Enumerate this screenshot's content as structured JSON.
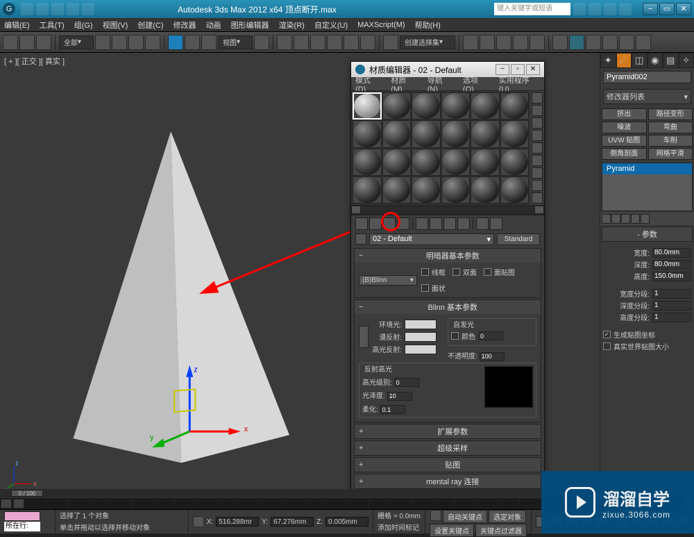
{
  "titlebar": {
    "title": "Autodesk 3ds Max  2012 x64    顶点断开.max",
    "search_placeholder": "键入关键字或短语"
  },
  "menubar": [
    "编辑(E)",
    "工具(T)",
    "组(G)",
    "视图(V)",
    "创建(C)",
    "修改器",
    "动画",
    "图形编辑器",
    "渲染(R)",
    "自定义(U)",
    "MAXScript(M)",
    "帮助(H)"
  ],
  "toolbar": {
    "group_dd": "全部",
    "view_dd": "视图",
    "select_set": "创建选择集"
  },
  "viewport_label": "[ + ][ 正交 ][ 真实 ]",
  "material_editor": {
    "title": "材质编辑器 - 02 - Default",
    "menu": [
      "模式(D)",
      "材质(M)",
      "导航(N)",
      "选项(O)",
      "实用程序(U)"
    ],
    "mat_name": "02 - Default",
    "mat_type": "Standard",
    "rollout_shader": "明暗器基本参数",
    "shader": "(B)Blinn",
    "check_wire": "线框",
    "check_2sided": "双面",
    "check_facemap": "面贴图",
    "check_faceted": "面状",
    "rollout_blinn": "Blinn 基本参数",
    "grp_selfillum": "自发光",
    "lbl_ambient": "环境光:",
    "lbl_diffuse": "漫反射:",
    "lbl_specular": "高光反射:",
    "lbl_color": "颜色",
    "lbl_opacity": "不透明度:",
    "val_opacity": "100",
    "grp_reflect": "反射高光",
    "lbl_speclevel": "高光级别:",
    "val_speclevel": "0",
    "lbl_gloss": "光泽度:",
    "val_gloss": "10",
    "lbl_soften": "柔化:",
    "val_soften": "0.1",
    "rollout_ext": "扩展参数",
    "rollout_super": "超级采样",
    "rollout_maps": "贴图",
    "rollout_mr": "mental ray 连接"
  },
  "cmdpanel": {
    "obj_name": "Pyramid002",
    "mod_dd": "修改器列表",
    "mod_btns": [
      "挤出",
      "路径变形",
      "噪波",
      "弯曲",
      "UVW 贴图",
      "车削",
      "倒角剖面",
      "网格平滑"
    ],
    "stack_item": "Pyramid",
    "rollout_params": "参数",
    "lbl_width": "宽度:",
    "val_width": "80.0mm",
    "lbl_depth": "深度:",
    "val_depth": "80.0mm",
    "lbl_height": "高度:",
    "val_height": "150.0mm",
    "lbl_wseg": "宽度分段:",
    "val_wseg": "1",
    "lbl_dseg": "深度分段:",
    "val_dseg": "1",
    "lbl_hseg": "高度分段:",
    "val_hseg": "1",
    "check_gen": "生成贴图坐标",
    "check_rw": "真实世界贴图大小"
  },
  "timeline": {
    "frame": "0 / 100"
  },
  "status": {
    "sel": "选择了 1 个对象",
    "prompt": "单击并拖动以选择并移动对象",
    "label_at": "所在行:",
    "x": "516.288mr",
    "y": "67.276mm",
    "z": "0.005mm",
    "grid_label": "栅格",
    "grid_val": "= 0.0mm",
    "autokey": "自动关键点",
    "selset": "选定对象",
    "setkey": "设置关键点",
    "keyfilt": "关键点过滤器",
    "addtime": "添加时间标记"
  },
  "watermark": {
    "big": "溜溜自学",
    "small": "zixue.3066.com"
  }
}
